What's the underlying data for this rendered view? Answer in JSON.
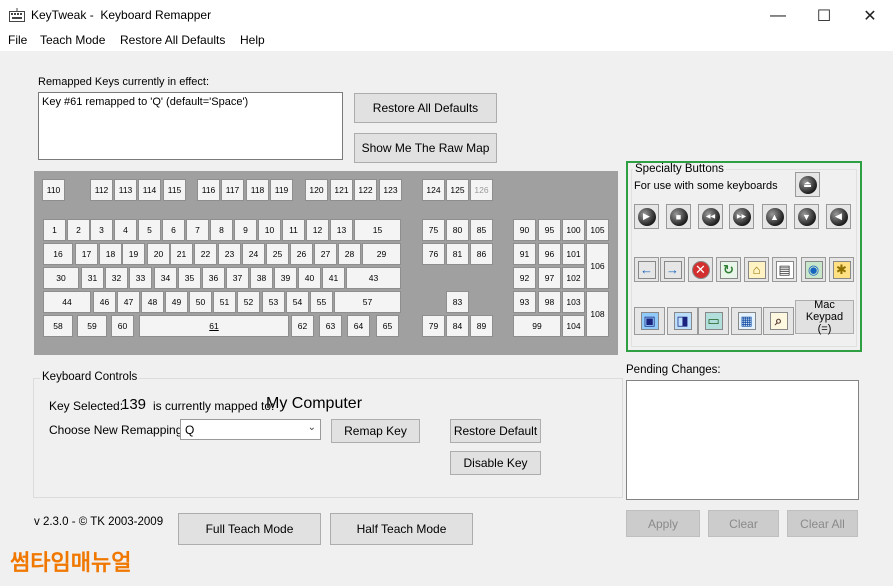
{
  "window": {
    "title": "KeyTweak -  Keyboard Remapper",
    "minimize": "—",
    "maximize": "☐",
    "close": "✕"
  },
  "menu": [
    "File",
    "Teach Mode",
    "Restore All Defaults",
    "Help"
  ],
  "remapped": {
    "label": "Remapped Keys currently in effect:",
    "entry": "Key #61 remapped to 'Q' (default='Space')",
    "restore_all_button": "Restore All Defaults",
    "raw_map_button": "Show Me The Raw Map"
  },
  "keyboard": {
    "keys": [
      "110",
      "112",
      "113",
      "114",
      "115",
      "116",
      "117",
      "118",
      "119",
      "120",
      "121",
      "122",
      "123",
      "124",
      "125",
      "126",
      "1",
      "2",
      "3",
      "4",
      "5",
      "6",
      "7",
      "8",
      "9",
      "10",
      "11",
      "12",
      "13",
      "15",
      "16",
      "17",
      "18",
      "19",
      "20",
      "21",
      "22",
      "23",
      "24",
      "25",
      "26",
      "27",
      "28",
      "29",
      "30",
      "31",
      "32",
      "33",
      "34",
      "35",
      "36",
      "37",
      "38",
      "39",
      "40",
      "41",
      "43",
      "44",
      "46",
      "47",
      "48",
      "49",
      "50",
      "51",
      "52",
      "53",
      "54",
      "55",
      "57",
      "58",
      "59",
      "60",
      "61",
      "62",
      "63",
      "64",
      "65",
      "75",
      "80",
      "85",
      "76",
      "81",
      "86",
      "83",
      "79",
      "84",
      "89",
      "90",
      "95",
      "100",
      "105",
      "91",
      "96",
      "101",
      "106",
      "92",
      "97",
      "102",
      "93",
      "98",
      "103",
      "108",
      "99",
      "104"
    ]
  },
  "specialty": {
    "title": "Specialty Buttons",
    "subtitle": "For use with some keyboards",
    "mac_keypad": "Mac Keypad (=)",
    "icons": [
      "eject-icon",
      "play-icon",
      "stop-icon",
      "rewind-icon",
      "fast-forward-icon",
      "volume-up-icon",
      "volume-down-icon",
      "mute-icon",
      "back-arrow-icon",
      "forward-arrow-icon",
      "stop-web-icon",
      "refresh-icon",
      "home-icon",
      "search-doc-icon",
      "favorites-icon",
      "media-icon",
      "my-computer-icon",
      "browser-icon",
      "computer-icon",
      "calculator-icon",
      "magnifier-icon"
    ]
  },
  "pending": {
    "label": "Pending Changes:",
    "apply": "Apply",
    "clear": "Clear",
    "clear_all": "Clear All"
  },
  "controls": {
    "group_label": "Keyboard Controls",
    "key_selected_label": "Key Selected:",
    "key_selected_value": "139",
    "mapped_to_label": "is currently mapped to:",
    "mapped_to_value": "My Computer",
    "choose_label": "Choose New Remapping",
    "choose_value": "Q",
    "remap_button": "Remap Key",
    "restore_default_button": "Restore Default",
    "disable_button": "Disable Key"
  },
  "footer": {
    "version": "v 2.3.0 - © TK 2003-2009",
    "full_teach": "Full Teach Mode",
    "half_teach": "Half Teach Mode",
    "watermark": "썸타임매뉴얼"
  },
  "colors": {
    "specialty_border": "#2ea043",
    "keyboard_bg": "#a0a0a0",
    "watermark": "#f07800"
  }
}
